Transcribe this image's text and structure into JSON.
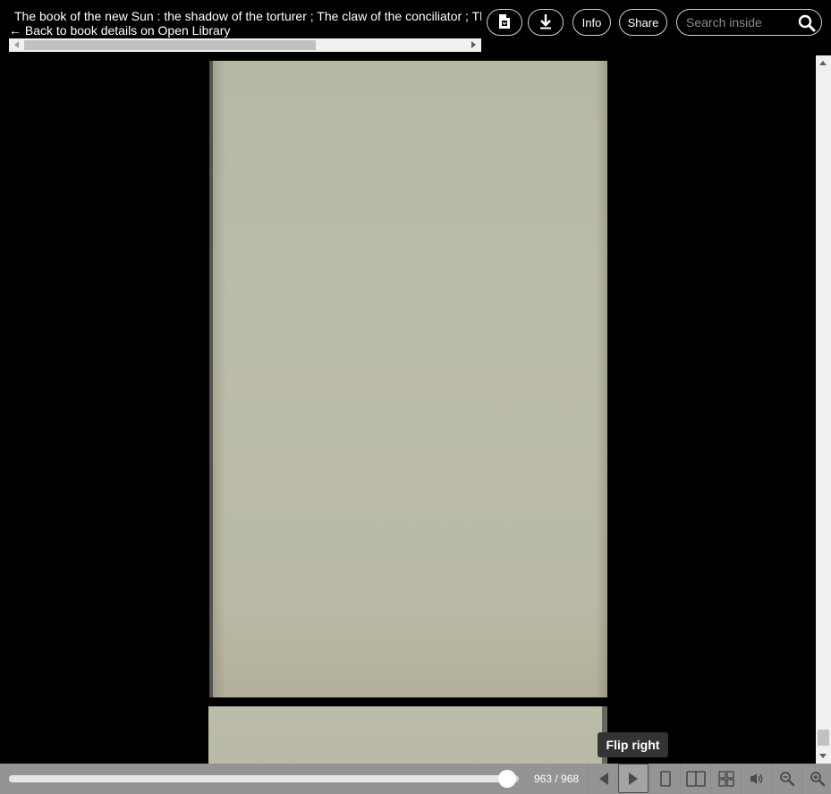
{
  "header": {
    "title": "The book of the new Sun : the shadow of the torturer ; The claw of the conciliator ; The sword of the lictor ; The citadel of the autarch",
    "back_link": "← Back to book details on Open Library",
    "buttons": {
      "info": "Info",
      "share": "Share"
    },
    "search": {
      "placeholder": "Search inside"
    }
  },
  "viewer": {
    "current_page": 963,
    "total_pages": 968,
    "page_count_text": "963 / 968",
    "progress": 0.9948
  },
  "tooltip": {
    "text": "Flip right"
  },
  "navbar": {
    "icons": [
      "flip-left-icon",
      "flip-right-icon",
      "one-page-view-icon",
      "two-page-view-icon",
      "thumbnail-view-icon",
      "read-aloud-icon",
      "zoom-out-icon",
      "zoom-in-icon"
    ]
  },
  "colors": {
    "background": "#000000",
    "navbar": "#949494",
    "page": "#bcbcaa",
    "tooltip": "#333333"
  }
}
